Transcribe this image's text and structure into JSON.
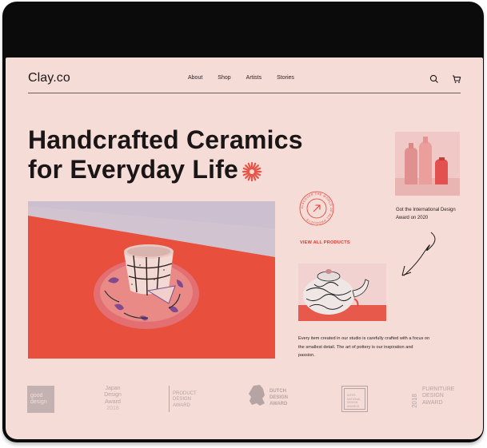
{
  "header": {
    "logo": "Clay.co",
    "nav": [
      {
        "label": "About"
      },
      {
        "label": "Shop"
      },
      {
        "label": "Artists"
      },
      {
        "label": "Stories"
      }
    ],
    "icons": [
      "search-icon",
      "cart-icon"
    ]
  },
  "hero": {
    "title_line1": "Handcrafted Ceramics",
    "title_line2": "for Everyday Life",
    "accent_color": "#e65548"
  },
  "award": {
    "text": "Got the International Design Award on 2020"
  },
  "badge": {
    "ring_text": "DISCOVER THE WORLD OF ALL PRODUCTS"
  },
  "view_all_label": "VIEW ALL PRODUCTS",
  "body_text": "Every item created in our studio is carefully crafted with a focus on the smallest detail. The art of pottery is our inspiration and passion.",
  "awards": {
    "good_design": "good design",
    "japan": [
      "Japan",
      "Design",
      "Award",
      "2018"
    ],
    "product": [
      "PRODUCT",
      "DESIGN",
      "AWARD"
    ],
    "dutch": [
      "DUTCH",
      "DESIGN",
      "AWARD"
    ],
    "international": [
      "INTER-",
      "NATIONAL",
      "DESIGN",
      "AWARDS"
    ],
    "furniture_year": "2018",
    "furniture": [
      "FURNITURE",
      "DESIGN",
      "AWARD"
    ]
  },
  "colors": {
    "background": "#f5dcd7",
    "accent": "#e0382c",
    "text": "#1a1516"
  }
}
